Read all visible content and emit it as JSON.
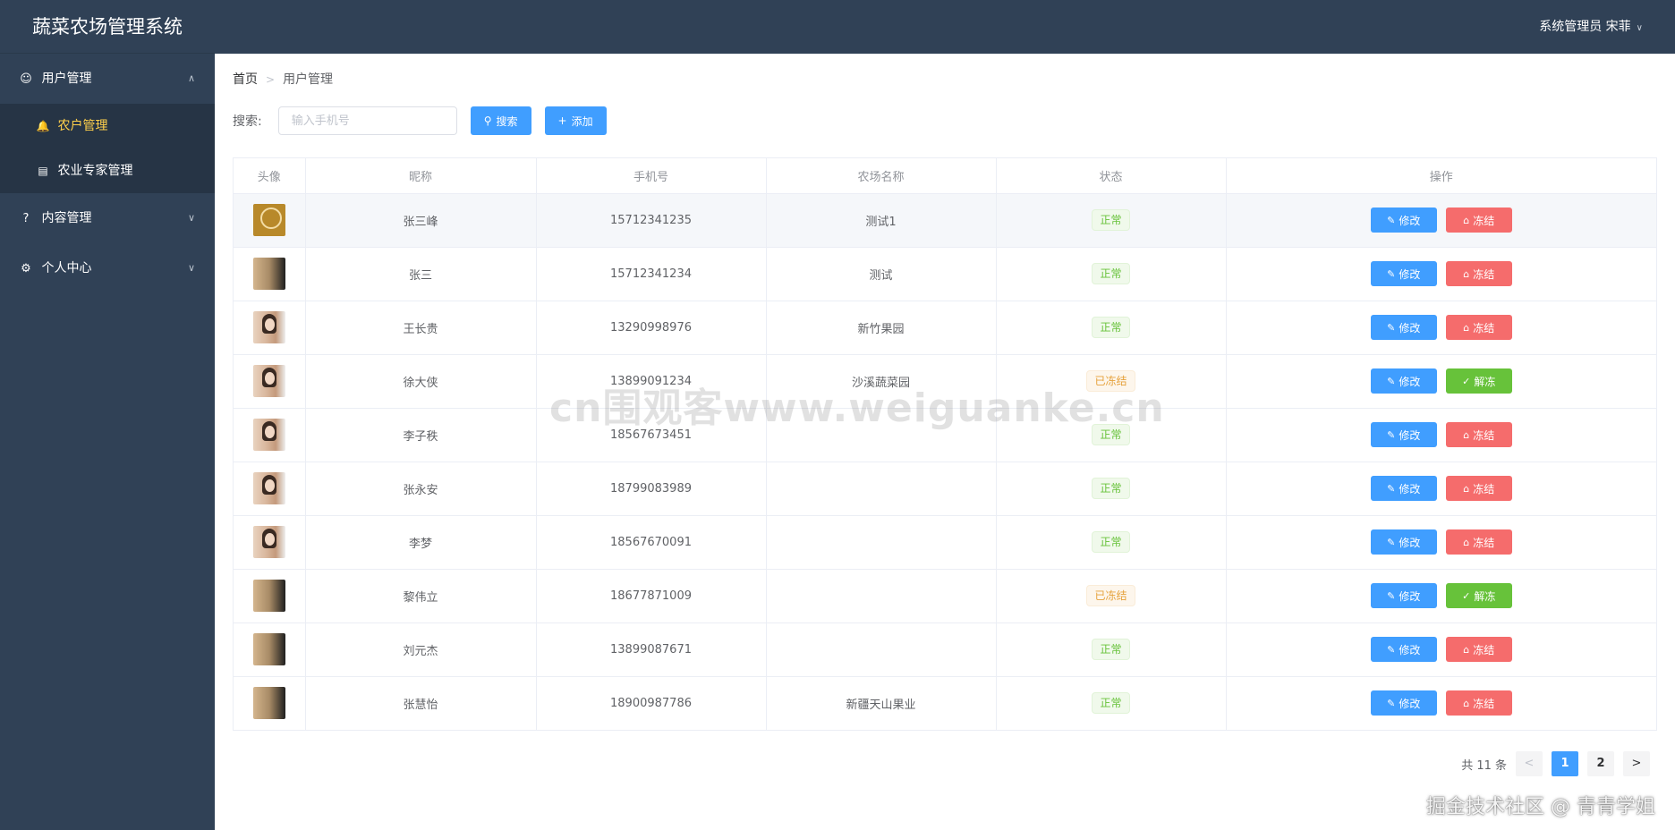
{
  "app_title": "蔬菜农场管理系统",
  "header": {
    "user_label": "系统管理员 宋菲"
  },
  "sidebar": {
    "groups": [
      {
        "label": "用户管理",
        "icon": "users-icon",
        "expanded": true
      },
      {
        "label": "内容管理",
        "icon": "question-icon",
        "expanded": false
      },
      {
        "label": "个人中心",
        "icon": "gears-icon",
        "expanded": false
      }
    ],
    "sub_items": [
      {
        "label": "农户管理",
        "icon": "bell-icon",
        "active": true
      },
      {
        "label": "农业专家管理",
        "icon": "id-card-icon",
        "active": false
      }
    ]
  },
  "breadcrumb": {
    "home": "首页",
    "current": "用户管理"
  },
  "search": {
    "label": "搜索:",
    "placeholder": "输入手机号",
    "search_button": "搜索",
    "add_button": "添加"
  },
  "table": {
    "columns": [
      "头像",
      "昵称",
      "手机号",
      "农场名称",
      "状态",
      "操作"
    ],
    "edit_label": "修改",
    "freeze_label": "冻结",
    "unfreeze_label": "解冻",
    "rows": [
      {
        "avatar": "gold-logo-avatar",
        "nickname": "张三峰",
        "phone": "15712341235",
        "farm": "测试1",
        "status": "正常"
      },
      {
        "avatar": "dark-person-avatar",
        "nickname": "张三",
        "phone": "15712341234",
        "farm": "测试",
        "status": "正常"
      },
      {
        "avatar": "person-avatar",
        "nickname": "王长贵",
        "phone": "13290998976",
        "farm": "新竹果园",
        "status": "正常"
      },
      {
        "avatar": "person-avatar",
        "nickname": "徐大侠",
        "phone": "13899091234",
        "farm": "沙溪蔬菜园",
        "status": "已冻结"
      },
      {
        "avatar": "person-avatar",
        "nickname": "李子秩",
        "phone": "18567673451",
        "farm": "",
        "status": "正常"
      },
      {
        "avatar": "person-avatar",
        "nickname": "张永安",
        "phone": "18799083989",
        "farm": "",
        "status": "正常"
      },
      {
        "avatar": "person-avatar",
        "nickname": "李梦",
        "phone": "18567670091",
        "farm": "",
        "status": "正常"
      },
      {
        "avatar": "dark-person-avatar",
        "nickname": "黎伟立",
        "phone": "18677871009",
        "farm": "",
        "status": "已冻结"
      },
      {
        "avatar": "dark-person-avatar",
        "nickname": "刘元杰",
        "phone": "13899087671",
        "farm": "",
        "status": "正常"
      },
      {
        "avatar": "dark-person-avatar",
        "nickname": "张慧怡",
        "phone": "18900987786",
        "farm": "新疆天山果业",
        "status": "正常"
      }
    ]
  },
  "pagination": {
    "total_label": "共 11 条",
    "pages": [
      "1",
      "2"
    ],
    "current_page": "1"
  },
  "watermarks": {
    "center": "cn围观客www.weiguanke.cn",
    "corner": "掘金技术社区 @ 青青学姐"
  },
  "colors": {
    "sidebar_bg": "#304156",
    "primary": "#409eff",
    "danger": "#f56c6c",
    "success": "#67c23a",
    "warning": "#e6a23c",
    "active_menu": "#ffd04b"
  }
}
